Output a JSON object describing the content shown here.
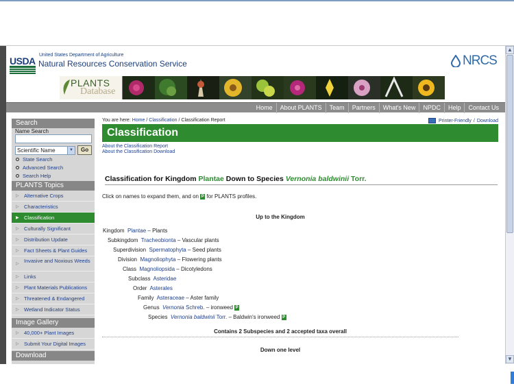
{
  "header": {
    "usda_logo_text": "USDA",
    "agency_small": "United States Department of Agriculture",
    "agency_big": "Natural Resources Conservation Service",
    "nrcs_logo_text": "NRCS"
  },
  "banner": {
    "logo_plants": "PLANTS",
    "logo_database": "Database"
  },
  "nav": [
    "Home",
    "About PLANTS",
    "Team",
    "Partners",
    "What's New",
    "NPDC",
    "Help",
    "Contact Us"
  ],
  "sidebar": {
    "search_heading": "Search",
    "name_search_label": "Name Search",
    "search_input_value": "",
    "select_value": "Scientific Name",
    "go_label": "Go",
    "search_links": [
      "State Search",
      "Advanced Search",
      "Search Help"
    ],
    "topics_heading": "PLANTS Topics",
    "topics": [
      "Alternative Crops",
      "Characteristics",
      "Classification",
      "Culturally Significant",
      "Distribution Update",
      "Fact Sheets & Plant Guides",
      "Invasive and Noxious Weeds",
      "Links",
      "Plant Materials Publications",
      "Threatened & Endangered",
      "Wetland Indicator Status"
    ],
    "image_gallery_heading": "Image Gallery",
    "gallery_links": [
      "40,000+ Plant Images",
      "Submit Your Digital Images"
    ],
    "download_heading": "Download"
  },
  "main": {
    "crumb_prefix": "You are here:",
    "crumb_home": "Home",
    "crumb_classification": "Classification",
    "crumb_sep": "/",
    "crumb_current": "Classification Report",
    "printer_friendly": "Printer-Friendly",
    "download": "Download",
    "title": "Classification",
    "about_report": "About the Classification Report",
    "about_download": "About the Classification Download",
    "cls_prefix": "Classification for Kingdom",
    "cls_kingdom": "Plantae",
    "cls_mid": "Down to Species",
    "cls_species": "Vernonia baldwinii",
    "cls_author": "Torr.",
    "intro_a": "Click on names to expand them, and on",
    "intro_b": "for PLANTS profiles.",
    "p_icon": "P",
    "up_to_kingdom": "Up to the Kingdom",
    "hierarchy": [
      {
        "rank": "Kingdom",
        "name": "Plantae",
        "author": "",
        "common": "– Plants"
      },
      {
        "rank": "Subkingdom",
        "name": "Tracheobionta",
        "author": "",
        "common": "– Vascular plants"
      },
      {
        "rank": "Superdivision",
        "name": "Spermatophyta",
        "author": "",
        "common": "– Seed plants"
      },
      {
        "rank": "Division",
        "name": "Magnoliophyta",
        "author": "",
        "common": "– Flowering plants"
      },
      {
        "rank": "Class",
        "name": "Magnoliopsida",
        "author": "",
        "common": "– Dicotyledons"
      },
      {
        "rank": "Subclass",
        "name": "Asteridae",
        "author": "",
        "common": ""
      },
      {
        "rank": "Order",
        "name": "Asterales",
        "author": "",
        "common": ""
      },
      {
        "rank": "Family",
        "name": "Asteraceae",
        "author": "",
        "common": "– Aster family"
      },
      {
        "rank": "Genus",
        "name": "Vernonia",
        "author": "Schreb.",
        "common": "– ironweed"
      },
      {
        "rank": "Species",
        "name": "Vernonia baldwinii",
        "author": "Torr.",
        "common": "– Baldwin's ironweed"
      }
    ],
    "contains": "Contains 2 Subspecies and 2 accepted taxa overall",
    "down_one": "Down one level"
  },
  "colors": {
    "usda_green": "#1b6d3a",
    "brand_blue": "#1b3d7a",
    "plants_green": "#2e8b30",
    "link_blue": "#1f3f8a",
    "nav_gray": "#8c8c8c",
    "sidebar_gray": "#d6d6d6"
  }
}
